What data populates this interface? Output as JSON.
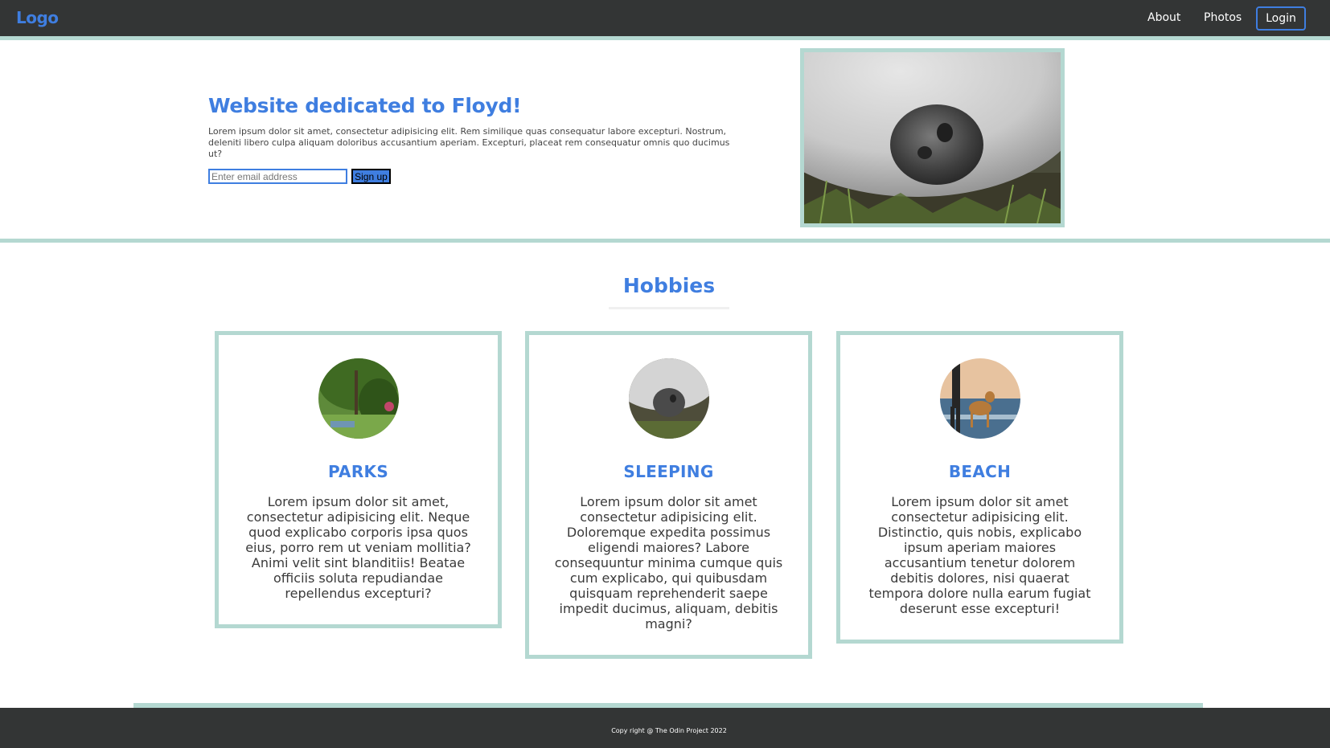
{
  "nav": {
    "logo": "Logo",
    "links": [
      "About",
      "Photos"
    ],
    "login_label": "Login"
  },
  "hero": {
    "title": "Website dedicated to Floyd!",
    "text": "Lorem ipsum dolor sit amet, consectetur adipisicing elit. Rem similique quas consequatur labore excepturi. Nostrum, deleniti libero culpa aliquam doloribus accusantium aperiam. Excepturi, placeat rem consequatur omnis quo ducimus ut?",
    "email_placeholder": "Enter email address",
    "signup_label": "Sign up"
  },
  "hobbies": {
    "title": "Hobbies",
    "cards": [
      {
        "title": "PARKS",
        "text": "Lorem ipsum dolor sit amet, consectetur adipisicing elit. Neque quod explicabo corporis ipsa quos eius, porro rem ut veniam mollitia? Animi velit sint blanditiis! Beatae officiis soluta repudiandae repellendus excepturi?"
      },
      {
        "title": "SLEEPING",
        "text": "Lorem ipsum dolor sit amet consectetur adipisicing elit. Doloremque expedita possimus eligendi maiores? Labore consequuntur minima cumque quis cum explicabo, qui quibusdam quisquam reprehenderit saepe impedit ducimus, aliquam, debitis magni?"
      },
      {
        "title": "BEACH",
        "text": "Lorem ipsum dolor sit amet consectetur adipisicing elit. Distinctio, quis nobis, explicabo ipsum aperiam maiores accusantium tenetur dolorem debitis dolores, nisi quaerat tempora dolore nulla earum fugiat deserunt esse excepturi!"
      }
    ]
  },
  "footer": {
    "text": "Copy right @ The Odin Project 2022"
  },
  "colors": {
    "accent": "#3f7ee0",
    "border": "#b4d8d1",
    "dark": "#333535"
  }
}
